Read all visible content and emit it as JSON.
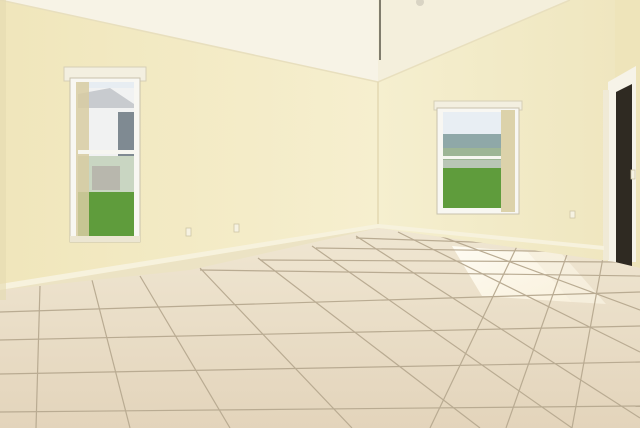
{
  "scene": {
    "description_visible_text": "",
    "colors": {
      "ceiling": "#f7f3e6",
      "left_wall": "#f2eac2",
      "back_wall": "#f4ecc6",
      "right_wall": "#efe6bd",
      "floor_tile": "#e9dcc4",
      "grout": "#b9ab92",
      "window_frame": "#f6f6f0",
      "grass": "#5f9c3c",
      "sky": "#e8eef3",
      "sunlight": "#fffbee",
      "door_dark": "#2f2a22"
    }
  }
}
